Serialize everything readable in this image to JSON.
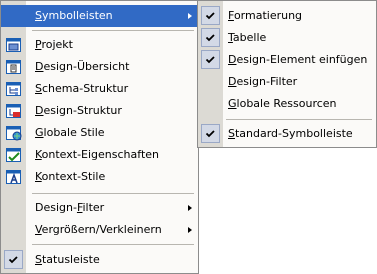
{
  "main_menu": {
    "toolbars_item": {
      "label_u": "S",
      "label_rest": "ymbolleisten"
    },
    "window_items": [
      {
        "label_u": "P",
        "label_rest": "rojekt",
        "icon": "project-window-icon"
      },
      {
        "label_u": "D",
        "label_rest": "esign-Übersicht",
        "icon": "design-overview-icon"
      },
      {
        "label_u": "S",
        "label_rest": "chema-Struktur",
        "icon": "schema-tree-icon"
      },
      {
        "label_u": "D",
        "label_rest": "esign-Struktur",
        "icon": "design-tree-icon"
      },
      {
        "label_u": "G",
        "label_rest": "lobale Stile",
        "icon": "global-styles-icon"
      },
      {
        "label_u": "K",
        "label_rest": "ontext-Eigenschaften",
        "icon": "properties-icon"
      },
      {
        "label_u": "K",
        "label_rest": "ontext-Stile",
        "icon": "styles-icon"
      }
    ],
    "design_filter": {
      "label_pre": "Design-",
      "label_u": "F",
      "label_rest": "ilter"
    },
    "zoom": {
      "label_pre": "",
      "label_u": "V",
      "label_rest": "ergrößern/Verkleinern"
    },
    "status_bar": {
      "label_pre": "",
      "label_u": "S",
      "label_rest": "tatusleiste",
      "checked": true
    }
  },
  "toolbars_submenu": {
    "items": [
      {
        "label_u": "F",
        "label_rest": "ormatierung",
        "checked": true
      },
      {
        "label_u": "T",
        "label_rest": "abelle",
        "checked": true
      },
      {
        "label_u": "D",
        "label_rest": "esign-Element einfügen",
        "checked": true
      },
      {
        "label_u": "D",
        "label_rest": "esign-Filter",
        "checked": false
      },
      {
        "label_u": "G",
        "label_rest": "lobale Ressourcen",
        "checked": false
      }
    ],
    "standard": {
      "label_u": "S",
      "label_rest": "tandard-Symbolleiste",
      "checked": true
    }
  },
  "colors": {
    "highlight": "#316ac5",
    "gutter": "#dcdad4",
    "menu_bg": "#fbfaf8"
  }
}
